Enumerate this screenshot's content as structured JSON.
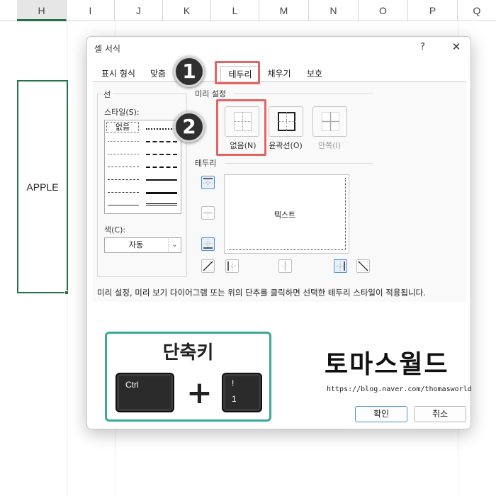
{
  "sheet": {
    "columns": [
      "H",
      "I",
      "J",
      "K",
      "L",
      "M",
      "N",
      "O",
      "P",
      "Q"
    ],
    "selected_column": "H",
    "cell_value": "APPLE"
  },
  "dialog": {
    "title": "셀 서식",
    "help_label": "?",
    "close_label": "✕",
    "tabs": [
      "표시 형식",
      "맞춤",
      "테두리",
      "채우기",
      "보호"
    ],
    "active_tab": "테두리",
    "line_group": {
      "title": "선",
      "style_label": "스타일(S):",
      "style_none": "없음",
      "color_label": "색(C):",
      "color_value": "자동"
    },
    "presets": {
      "title": "미리 설정",
      "none_label": "없음(N)",
      "outline_label": "윤곽선(O)",
      "inside_label": "안쪽(I)"
    },
    "border": {
      "title": "테두리",
      "preview_text": "텍스트"
    },
    "description": "미리 설정, 미리 보기 다이어그램 또는 위의 단추를 클릭하면 선택한 테두리 스타일이 적용됩니다.",
    "ok_label": "확인",
    "cancel_label": "취소"
  },
  "annotations": {
    "badge1": "1",
    "badge2": "2"
  },
  "shortcut": {
    "title": "단축키",
    "key1": "Ctrl",
    "key2_top": "!",
    "key2_bottom": "1",
    "plus": "+"
  },
  "brand": {
    "name": "토마스월드",
    "url": "https://blog.naver.com/thomasworld"
  },
  "colors": {
    "excel_green": "#217346",
    "highlight_red": "#e06666",
    "shortcut_teal": "#3aa897",
    "focus_blue": "#4a90d9"
  }
}
